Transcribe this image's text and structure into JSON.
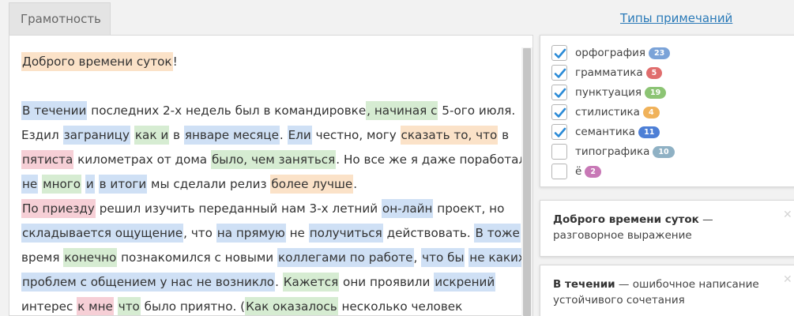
{
  "tab": {
    "label": "Грамотность"
  },
  "header": {
    "types_link": "Типы примечаний"
  },
  "colors": {
    "spell": "#cfe0f5",
    "grammar": "#f6cfd6",
    "punctuation": "#d6ecd2",
    "style": "#fbe2c8"
  },
  "filters": [
    {
      "label": "орфография",
      "count": "23",
      "checked": true,
      "color": "#7ba3d8"
    },
    {
      "label": "грамматика",
      "count": "5",
      "checked": true,
      "color": "#e06d6d"
    },
    {
      "label": "пунктуация",
      "count": "19",
      "checked": true,
      "color": "#8cc474"
    },
    {
      "label": "стилистика",
      "count": "4",
      "checked": true,
      "color": "#f0b25a"
    },
    {
      "label": "семантика",
      "count": "11",
      "checked": true,
      "color": "#4d7fd6"
    },
    {
      "label": "типографика",
      "count": "10",
      "checked": false,
      "color": "#8fb1c4"
    },
    {
      "label": "ё",
      "count": "2",
      "checked": false,
      "color": "#c878b6"
    }
  ],
  "cards": [
    {
      "term": "Доброго времени суток",
      "desc": "разговорное выражение"
    },
    {
      "term": "В течении",
      "desc": "ошибочное написание устойчивого сочетания"
    }
  ],
  "lines": [
    [
      [
        "Доброго времени суток",
        "style"
      ],
      [
        "!",
        ""
      ]
    ],
    [],
    [
      [
        "В течении",
        "spell"
      ],
      [
        " последних 2-х недель был в командировке",
        ""
      ],
      [
        ", начиная с",
        "punct"
      ],
      [
        " 5-ого июля.",
        ""
      ]
    ],
    [
      [
        "Ездил ",
        ""
      ],
      [
        "заграницу",
        "spell"
      ],
      [
        " ",
        ""
      ],
      [
        "как и",
        "punct"
      ],
      [
        " в ",
        ""
      ],
      [
        "январе месяце",
        "spell"
      ],
      [
        ". ",
        ""
      ],
      [
        "Ели",
        "spell"
      ],
      [
        " честно, могу ",
        ""
      ],
      [
        "сказать то, что",
        "style"
      ],
      [
        " в",
        ""
      ]
    ],
    [
      [
        "пятиста",
        "gram"
      ],
      [
        " километрах от дома ",
        ""
      ],
      [
        "было, чем заняться",
        "punct"
      ],
      [
        ". Но все же я даже поработал",
        ""
      ]
    ],
    [
      [
        "не",
        "spell"
      ],
      [
        " ",
        ""
      ],
      [
        "много",
        "punct"
      ],
      [
        " ",
        ""
      ],
      [
        "и",
        "spell"
      ],
      [
        " ",
        ""
      ],
      [
        "в итоги",
        "spell"
      ],
      [
        " мы сделали релиз ",
        ""
      ],
      [
        "более лучше",
        "style"
      ],
      [
        ".",
        ""
      ]
    ],
    [
      [
        "По приезду",
        "gram"
      ],
      [
        " решил изучить переданный нам 3-х летний ",
        ""
      ],
      [
        "он-лайн",
        "spell"
      ],
      [
        " проект, но",
        ""
      ]
    ],
    [
      [
        "складывается ощущение",
        "spell"
      ],
      [
        ", что ",
        ""
      ],
      [
        "на прямую",
        "spell"
      ],
      [
        " не ",
        ""
      ],
      [
        "получиться",
        "spell"
      ],
      [
        " действовать. ",
        ""
      ],
      [
        "В тоже",
        "spell"
      ]
    ],
    [
      [
        "время ",
        ""
      ],
      [
        "конечно",
        "punct"
      ],
      [
        " познакомился с новыми ",
        ""
      ],
      [
        "коллегами по работе",
        "spell"
      ],
      [
        ", ",
        ""
      ],
      [
        "что бы",
        "spell"
      ],
      [
        " ",
        ""
      ],
      [
        "не каких",
        "spell"
      ]
    ],
    [
      [
        "проблем с общением у нас не возникло",
        "spell"
      ],
      [
        ". ",
        ""
      ],
      [
        "Кажется",
        "punct"
      ],
      [
        " они проявили ",
        ""
      ],
      [
        "искрений",
        "spell"
      ]
    ],
    [
      [
        "интерес ",
        ""
      ],
      [
        "к мне",
        "gram"
      ],
      [
        " ",
        ""
      ],
      [
        "что",
        "punct"
      ],
      [
        " было приятно. (",
        ""
      ],
      [
        "Как оказалось",
        "punct"
      ],
      [
        " несколько человек",
        ""
      ]
    ]
  ]
}
